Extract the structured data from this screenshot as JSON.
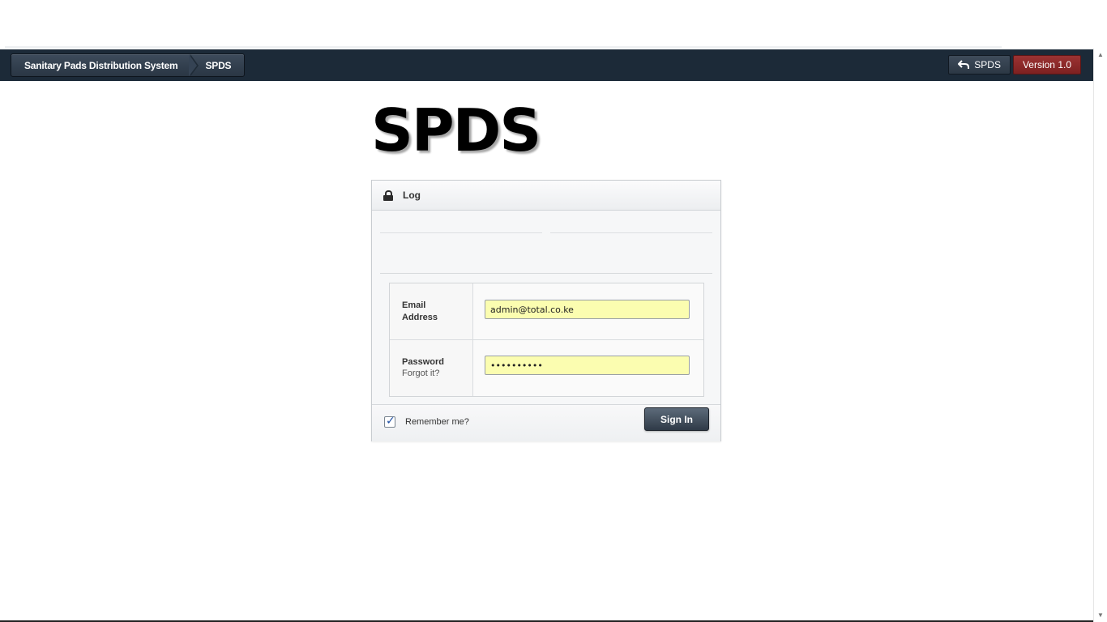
{
  "header": {
    "breadcrumb": [
      "Sanitary Pads Distribution System",
      "SPDS"
    ],
    "back_button_label": "SPDS",
    "version_label": "Version 1.0"
  },
  "logo": {
    "text": "SPDS"
  },
  "login": {
    "title": "Log",
    "email": {
      "label": "Email Address",
      "value": "admin@total.co.ke"
    },
    "password": {
      "label": "Password",
      "masked_value": "••••••••••",
      "forgot_link": "Forgot it?"
    },
    "remember_label": "Remember me?",
    "remember_checked": true,
    "signin_label": "Sign In"
  },
  "colors": {
    "header_bg": "#1c2a38",
    "version_badge": "#8b2828",
    "input_autofill": "#fbfdb0"
  },
  "icons": [
    "back-arrow-icon",
    "lock-icon",
    "checkmark-icon",
    "scroll-up-icon",
    "scroll-down-icon"
  ]
}
